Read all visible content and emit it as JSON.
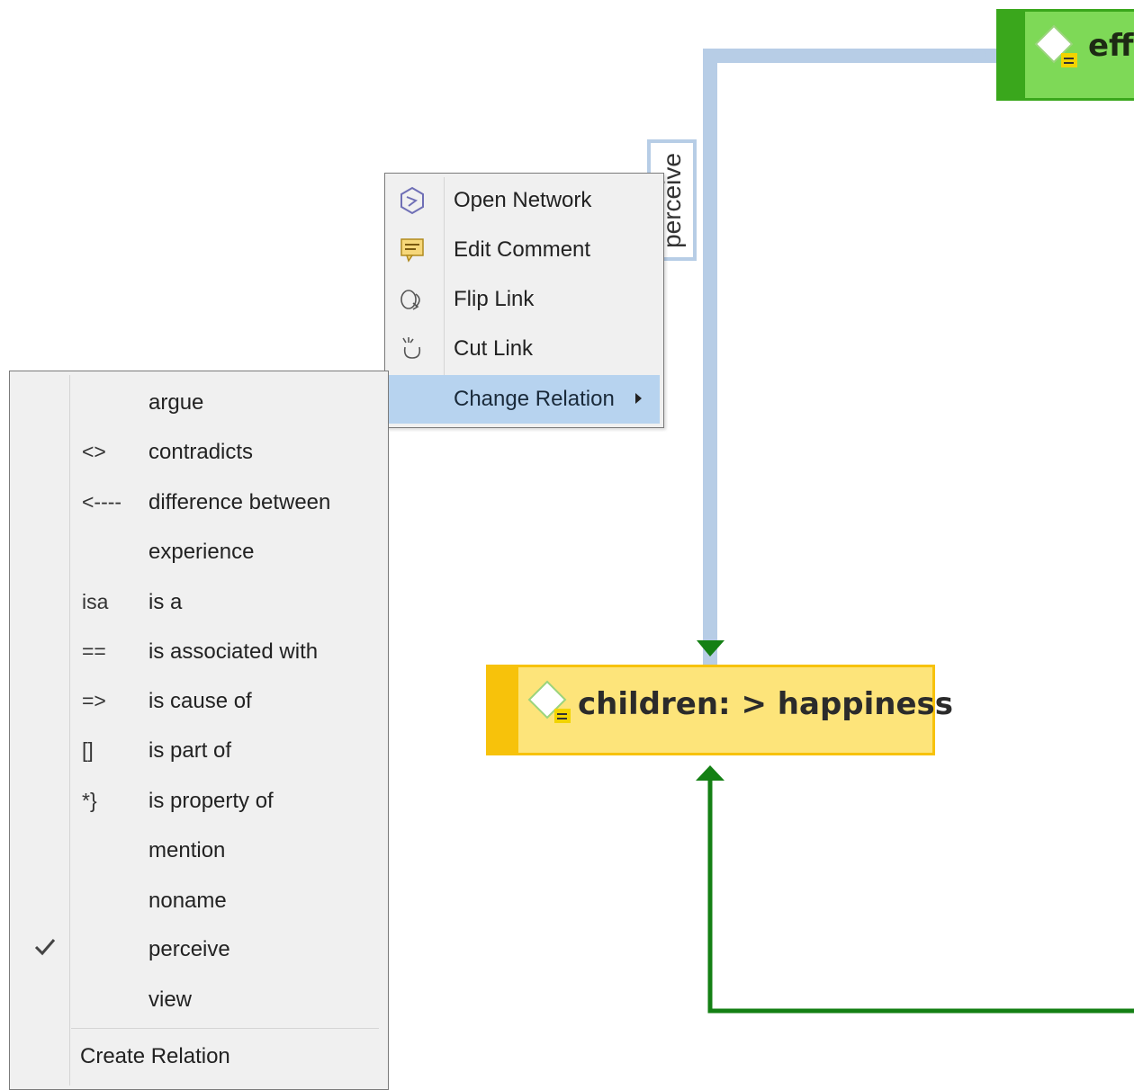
{
  "canvas": {
    "link_color": "#b7cde6",
    "arrow_color": "#148014",
    "link_label": "perceive"
  },
  "nodes": {
    "effect": {
      "label": "eff",
      "fill": "#7ed957",
      "border": "#3aa71c",
      "icon": "node-diamond-comment-icon"
    },
    "children": {
      "label": "children: > happiness",
      "fill": "#fde47a",
      "border": "#f7c20b",
      "icon": "node-diamond-comment-icon"
    }
  },
  "context_menu": {
    "items": [
      {
        "label": "Open Network",
        "icon": "network-icon"
      },
      {
        "label": "Edit Comment",
        "icon": "comment-icon"
      },
      {
        "label": "Flip Link",
        "icon": "flip-link-icon"
      },
      {
        "label": "Cut Link",
        "icon": "cut-link-icon"
      },
      {
        "label": "Change Relation",
        "icon": "",
        "has_submenu": true,
        "highlighted": true
      }
    ]
  },
  "relation_menu": {
    "items": [
      {
        "symbol": "",
        "label": "argue"
      },
      {
        "symbol": "<>",
        "label": "contradicts"
      },
      {
        "symbol": "<----",
        "label": "difference between"
      },
      {
        "symbol": "",
        "label": "experience"
      },
      {
        "symbol": "isa",
        "label": "is a"
      },
      {
        "symbol": "==",
        "label": "is associated with"
      },
      {
        "symbol": "=>",
        "label": "is cause of"
      },
      {
        "symbol": "[]",
        "label": "is part of"
      },
      {
        "symbol": "*}",
        "label": "is property of"
      },
      {
        "symbol": "",
        "label": "mention"
      },
      {
        "symbol": "",
        "label": "noname"
      },
      {
        "symbol": "",
        "label": "perceive",
        "checked": true
      },
      {
        "symbol": "",
        "label": "view"
      }
    ],
    "create_label": "Create Relation"
  }
}
